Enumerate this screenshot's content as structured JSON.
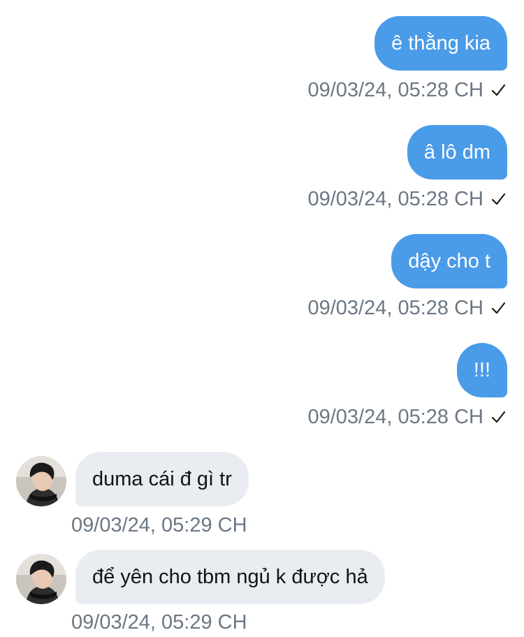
{
  "messages": [
    {
      "direction": "out",
      "text": "ê thằng kia",
      "timestamp": "09/03/24, 05:28 CH",
      "status_icon": "check-icon"
    },
    {
      "direction": "out",
      "text": "â lô dm",
      "timestamp": "09/03/24, 05:28 CH",
      "status_icon": "check-icon"
    },
    {
      "direction": "out",
      "text": "dậy cho t",
      "timestamp": "09/03/24, 05:28 CH",
      "status_icon": "check-icon"
    },
    {
      "direction": "out",
      "text": "!!!",
      "timestamp": "09/03/24, 05:28 CH",
      "status_icon": "check-icon"
    },
    {
      "direction": "in",
      "text": "duma cái đ gì tr",
      "timestamp": "09/03/24, 05:29 CH",
      "avatar_icon": "avatar"
    },
    {
      "direction": "in",
      "text": "để yên cho tbm ngủ k được hả",
      "timestamp": "09/03/24, 05:29 CH",
      "avatar_icon": "avatar"
    }
  ],
  "colors": {
    "outgoing_bubble": "#4a9be8",
    "incoming_bubble": "#e9edf1",
    "timestamp_text": "#6b7784"
  }
}
